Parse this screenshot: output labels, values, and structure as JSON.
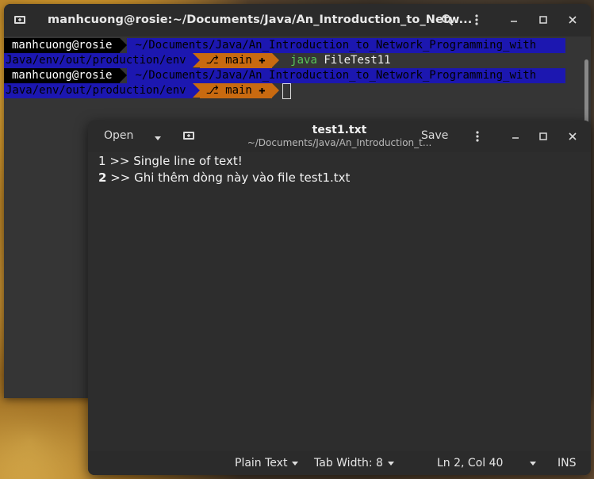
{
  "terminal": {
    "title": "manhcuong@rosie:~/Documents/Java/An_Introduction_to_Netw...",
    "prompt_user": "manhcuong@rosie",
    "prompt_path_line1": "~/Documents/Java/An_Introduction_to_Network_Programming_with",
    "prompt_path_line2": "Java/env/out/production/env",
    "git_branch": " main ✚",
    "command_name": "java",
    "command_arg": "FileTest11"
  },
  "editor": {
    "open_label": "Open",
    "save_label": "Save",
    "title": "test1.txt",
    "subtitle": "~/Documents/Java/An_Introduction_t...",
    "lines": [
      {
        "num": "1",
        "text": " >> Single line of text!"
      },
      {
        "num": "2",
        "text": " >> Ghi thêm dòng này vào file test1.txt"
      }
    ],
    "status": {
      "syntax": "Plain Text",
      "tab_width": "Tab Width: 8",
      "position": "Ln 2, Col 40",
      "mode": "INS"
    }
  },
  "colors": {
    "prompt_user_bg": "#000000",
    "prompt_path_bg": "#1c17b0",
    "git_segment_bg": "#c96a10",
    "command_green": "#58c558"
  },
  "icons": [
    "new-tab-icon",
    "search-icon",
    "menu-icon",
    "minimize-icon",
    "maximize-icon",
    "close-icon",
    "git-branch-icon",
    "chevron-down-icon",
    "pin-tab-icon"
  ]
}
